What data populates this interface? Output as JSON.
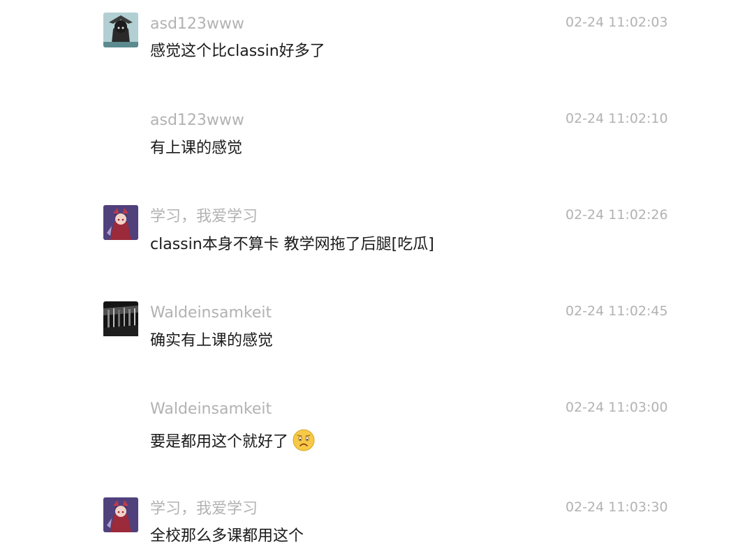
{
  "messages": [
    {
      "user": "asd123www",
      "time": "02-24 11:02:03",
      "text": "感觉这个比classin好多了",
      "avatar": "dark-character-avatar"
    },
    {
      "user": "asd123www",
      "time": "02-24 11:02:10",
      "text": "有上课的感觉"
    },
    {
      "user": "学习，我爱学习",
      "time": "02-24 11:02:26",
      "text": "classin本身不算卡 教学网拖了后腿[吃瓜]",
      "avatar": "purple-character-avatar"
    },
    {
      "user": "Waldeinsamkeit",
      "time": "02-24 11:02:45",
      "text": "确实有上课的感觉",
      "avatar": "dark-forest-avatar"
    },
    {
      "user": "Waldeinsamkeit",
      "time": "02-24 11:03:00",
      "text": "要是都用这个就好了",
      "emoji": "sad-face-emoji"
    },
    {
      "user": "学习，我爱学习",
      "time": "02-24 11:03:30",
      "text": "全校那么多课都用这个",
      "avatar": "purple-character-avatar"
    }
  ]
}
